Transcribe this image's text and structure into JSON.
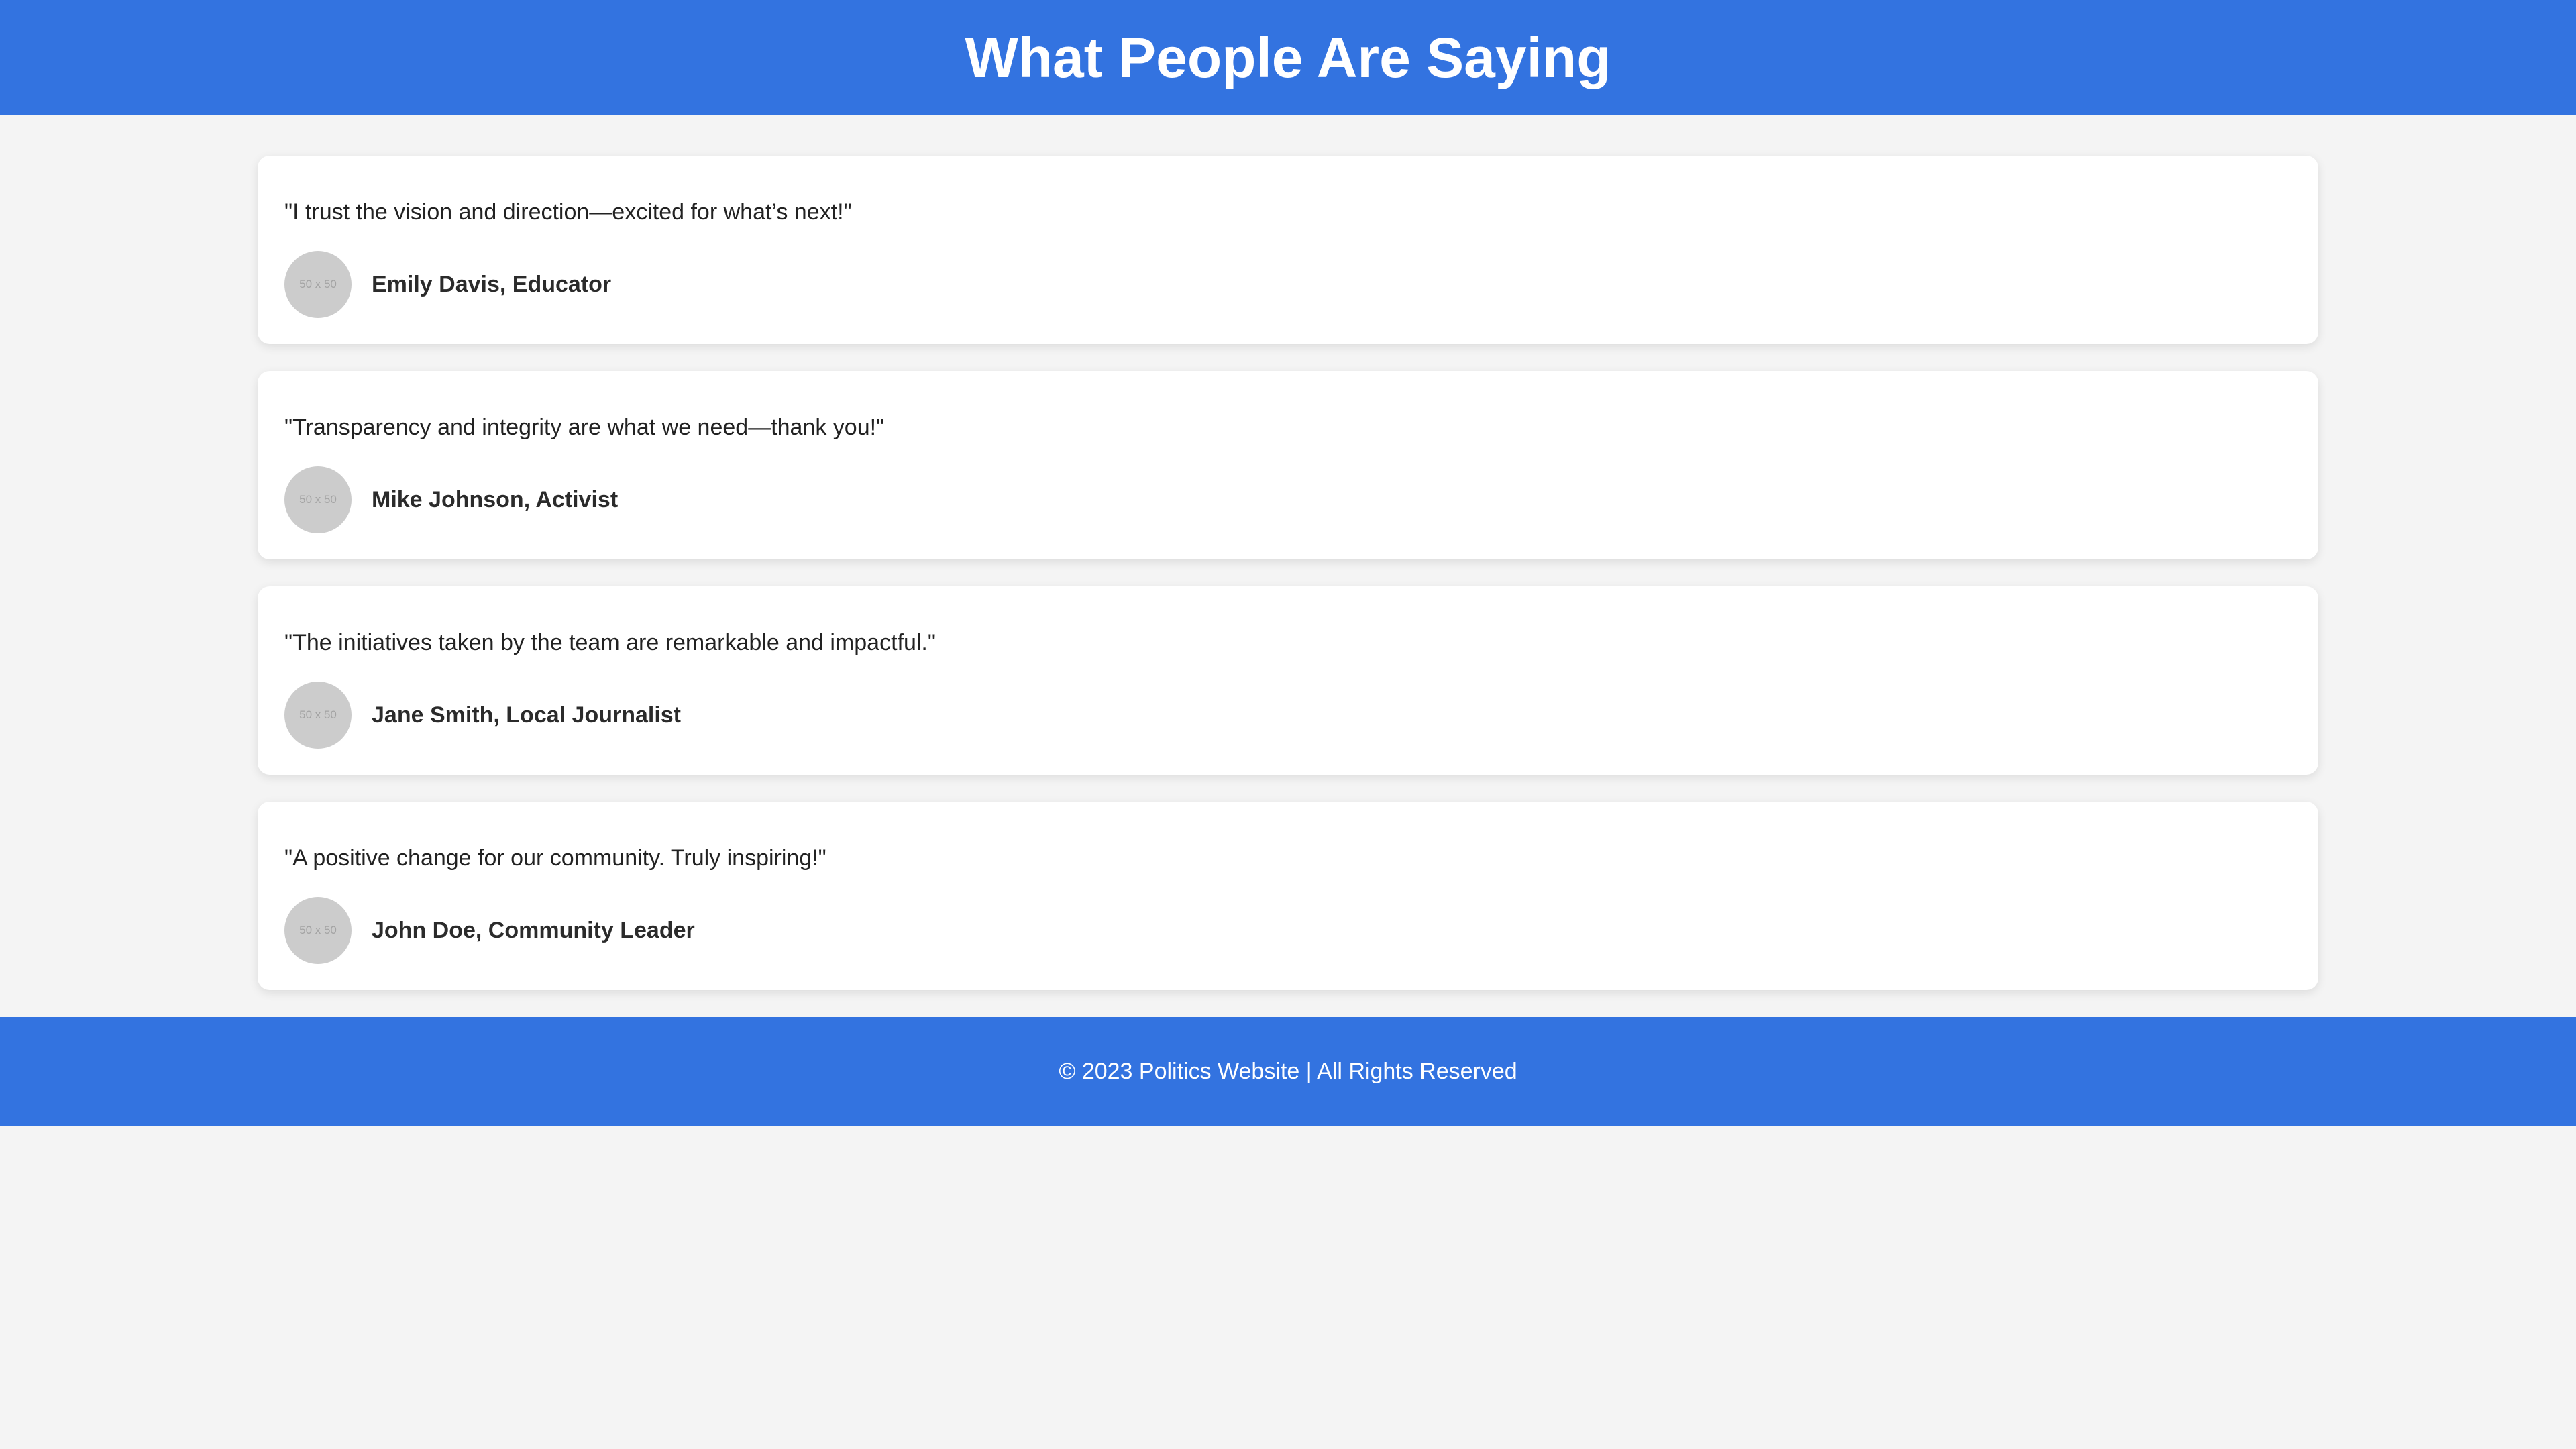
{
  "header": {
    "title": "What People Are Saying"
  },
  "testimonials": [
    {
      "quote": "\"I trust the vision and direction—excited for what’s next!\"",
      "avatar_label": "50 x 50",
      "author": "Emily Davis, Educator"
    },
    {
      "quote": "\"Transparency and integrity are what we need—thank you!\"",
      "avatar_label": "50 x 50",
      "author": "Mike Johnson, Activist"
    },
    {
      "quote": "\"The initiatives taken by the team are remarkable and impactful.\"",
      "avatar_label": "50 x 50",
      "author": "Jane Smith, Local Journalist"
    },
    {
      "quote": "\"A positive change for our community. Truly inspiring!\"",
      "avatar_label": "50 x 50",
      "author": "John Doe, Community Leader"
    }
  ],
  "footer": {
    "text": "© 2023 Politics Website | All Rights Reserved"
  },
  "colors": {
    "brand_blue": "#3373e0",
    "page_background": "#f4f4f4",
    "card_background": "#ffffff",
    "avatar_placeholder": "#cccccc"
  }
}
